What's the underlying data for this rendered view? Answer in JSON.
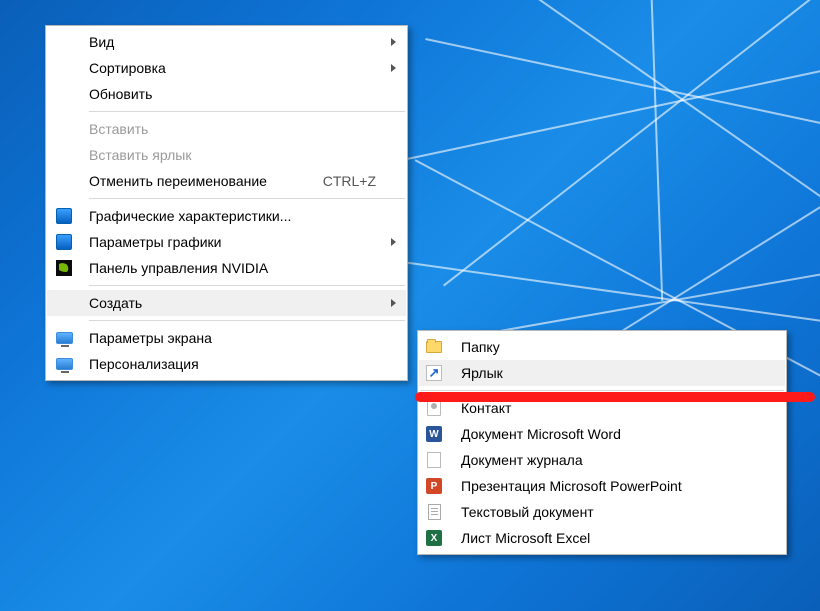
{
  "primary_menu": {
    "items": {
      "view": {
        "label": "Вид"
      },
      "sort": {
        "label": "Сортировка"
      },
      "refresh": {
        "label": "Обновить"
      },
      "paste": {
        "label": "Вставить"
      },
      "paste_link": {
        "label": "Вставить ярлык"
      },
      "undo_rename": {
        "label": "Отменить переименование",
        "shortcut": "CTRL+Z"
      },
      "gfx_props": {
        "label": "Графические характеристики..."
      },
      "gfx_params": {
        "label": "Параметры графики"
      },
      "nvidia": {
        "label": "Панель управления NVIDIA"
      },
      "new": {
        "label": "Создать"
      },
      "display": {
        "label": "Параметры экрана"
      },
      "personalize": {
        "label": "Персонализация"
      }
    }
  },
  "submenu": {
    "items": {
      "folder": {
        "label": "Папку"
      },
      "shortcut": {
        "label": "Ярлык"
      },
      "contact": {
        "label": "Контакт"
      },
      "word": {
        "label": "Документ Microsoft Word"
      },
      "journal": {
        "label": "Документ журнала"
      },
      "ppt": {
        "label": "Презентация Microsoft PowerPoint"
      },
      "txt": {
        "label": "Текстовый документ"
      },
      "excel": {
        "label": "Лист Microsoft Excel"
      }
    }
  },
  "glyphs": {
    "word": "W",
    "ppt": "P",
    "excel": "X",
    "arrow": "↗"
  }
}
